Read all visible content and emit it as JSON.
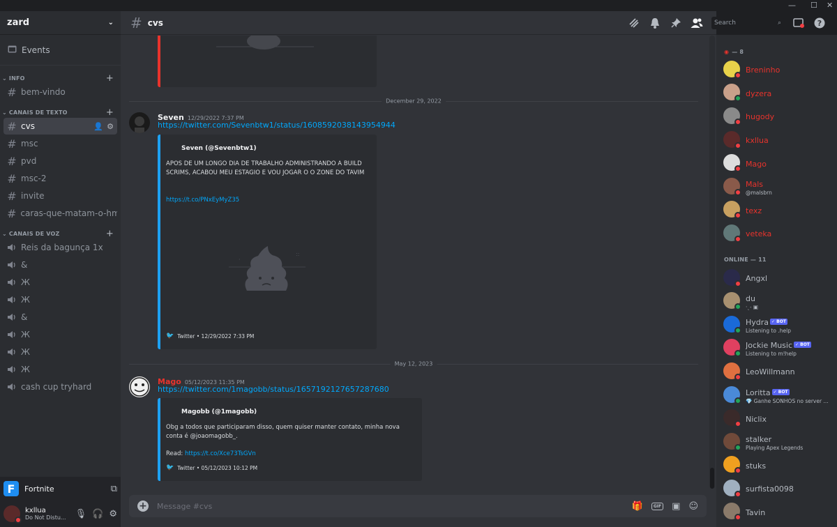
{
  "window": {
    "minimize": "—",
    "maximize": "☐",
    "close": "✕"
  },
  "server": {
    "name": "zard",
    "events_label": "Events"
  },
  "categories": {
    "info": {
      "label": "INFO",
      "channels": [
        {
          "name": "bem-vindo"
        }
      ]
    },
    "text": {
      "label": "CANAIS DE TEXTO",
      "channels": [
        {
          "name": "cvs"
        },
        {
          "name": "msc"
        },
        {
          "name": "pvd"
        },
        {
          "name": "msc-2"
        },
        {
          "name": "invite"
        },
        {
          "name": "caras-que-matam-o-hm..."
        }
      ]
    },
    "voice": {
      "label": "CANAIS DE VOZ",
      "channels": [
        {
          "name": "Reis da bagunça 1x"
        },
        {
          "name": "&"
        },
        {
          "name": "Ж"
        },
        {
          "name": "Ж"
        },
        {
          "name": "&"
        },
        {
          "name": "Ж"
        },
        {
          "name": "Ж"
        },
        {
          "name": "Ж"
        },
        {
          "name": "cash cup tryhard"
        }
      ]
    }
  },
  "activity": {
    "game": "Fortnite",
    "icon_letter": "F"
  },
  "user": {
    "name": "kxllua",
    "status": "Do Not Distu..."
  },
  "channel": {
    "name": "cvs",
    "input_placeholder": "Message #cvs"
  },
  "search": {
    "placeholder": "Search"
  },
  "dividers": [
    "December 29, 2022",
    "May 12, 2023"
  ],
  "messages": [
    {
      "author": "Seven",
      "author_color": "#f2f3f5",
      "timestamp": "12/29/2022 7:37 PM",
      "link": "https://twitter.com/Sevenbtw1/status/1608592038143954944",
      "embed": {
        "author": "Seven (@Sevenbtw1)",
        "text": "APOS DE UM LONGO DIA DE TRABALHO ADMINISTRANDO A BUILD SCRIMS, ACABOU MEU ESTAGIO E VOU JOGAR O O ZONE DO TAVIM",
        "link": "https://t.co/PNxEyMyZ35",
        "footer": "Twitter • 12/29/2022 7:33 PM"
      }
    },
    {
      "author": "Mago",
      "author_color": "#e8332c",
      "timestamp": "05/12/2023 11:35 PM",
      "link": "https://twitter.com/1magobb/status/1657192127657287680",
      "embed": {
        "author": "Magobb (@1magobb)",
        "text": "Obg a todos que participaram disso, quem quiser manter contato, minha nova conta é @joaomagobb_.",
        "read_label": "Read:",
        "link": "https://t.co/Xce73TsGVn",
        "footer": "Twitter • 05/12/2023 10:12 PM"
      }
    }
  ],
  "member_groups": [
    {
      "label": "— 8",
      "members": [
        {
          "name": "Breninho",
          "color": "#e8332c",
          "avatar": "#e8d24a",
          "status": "dnd"
        },
        {
          "name": "dyzera",
          "color": "#e8332c",
          "avatar": "#c9a08a",
          "status": "online"
        },
        {
          "name": "hugody",
          "color": "#e8332c",
          "avatar": "#8a8a8a",
          "status": "dnd"
        },
        {
          "name": "kxllua",
          "color": "#e8332c",
          "avatar": "#5a2a2a",
          "status": "dnd"
        },
        {
          "name": "Mago",
          "color": "#e8332c",
          "avatar": "#dddddd",
          "status": "dnd"
        },
        {
          "name": "Mals",
          "color": "#e8332c",
          "avatar": "#8a5a4a",
          "status": "dnd",
          "sub": "@malsbrn"
        },
        {
          "name": "texz",
          "color": "#e8332c",
          "avatar": "#c8a060",
          "status": "dnd"
        },
        {
          "name": "veteka",
          "color": "#e8332c",
          "avatar": "#607878",
          "status": "dnd"
        }
      ]
    },
    {
      "label": "ONLINE — 11",
      "members": [
        {
          "name": "Angxl",
          "color": "#b5bac1",
          "avatar": "#2a2a4a",
          "status": "dnd"
        },
        {
          "name": "du",
          "color": "#b5bac1",
          "avatar": "#a89070",
          "status": "online",
          "sub": "·ˎ˗ ▣"
        },
        {
          "name": "Hydra",
          "color": "#b5bac1",
          "avatar": "#1a6ad8",
          "status": "online",
          "bot": "✓ BOT",
          "sub": "Listening to .help"
        },
        {
          "name": "Jockie Music",
          "color": "#b5bac1",
          "avatar": "#e04060",
          "status": "online",
          "bot": "✓ BOT",
          "sub": "Listening to m!help"
        },
        {
          "name": "LeoWillmann",
          "color": "#b5bac1",
          "avatar": "#e07040",
          "status": "dnd"
        },
        {
          "name": "Loritta",
          "color": "#b5bac1",
          "avatar": "#4a8ad8",
          "status": "online",
          "bot": "✓ BOT",
          "sub": "💎 Ganhe SONHOS no server ..."
        },
        {
          "name": "Niclix",
          "color": "#b5bac1",
          "avatar": "#3a2a2a",
          "status": "dnd"
        },
        {
          "name": "stalker",
          "color": "#b5bac1",
          "avatar": "#704a3a",
          "status": "online",
          "sub": "Playing Apex Legends"
        },
        {
          "name": "stuks",
          "color": "#b5bac1",
          "avatar": "#f0a020",
          "status": "dnd"
        },
        {
          "name": "surfista0098",
          "color": "#b5bac1",
          "avatar": "#a0b0c0",
          "status": "dnd"
        },
        {
          "name": "Tavin",
          "color": "#b5bac1",
          "avatar": "#8a7a6a",
          "status": "dnd"
        }
      ]
    }
  ]
}
